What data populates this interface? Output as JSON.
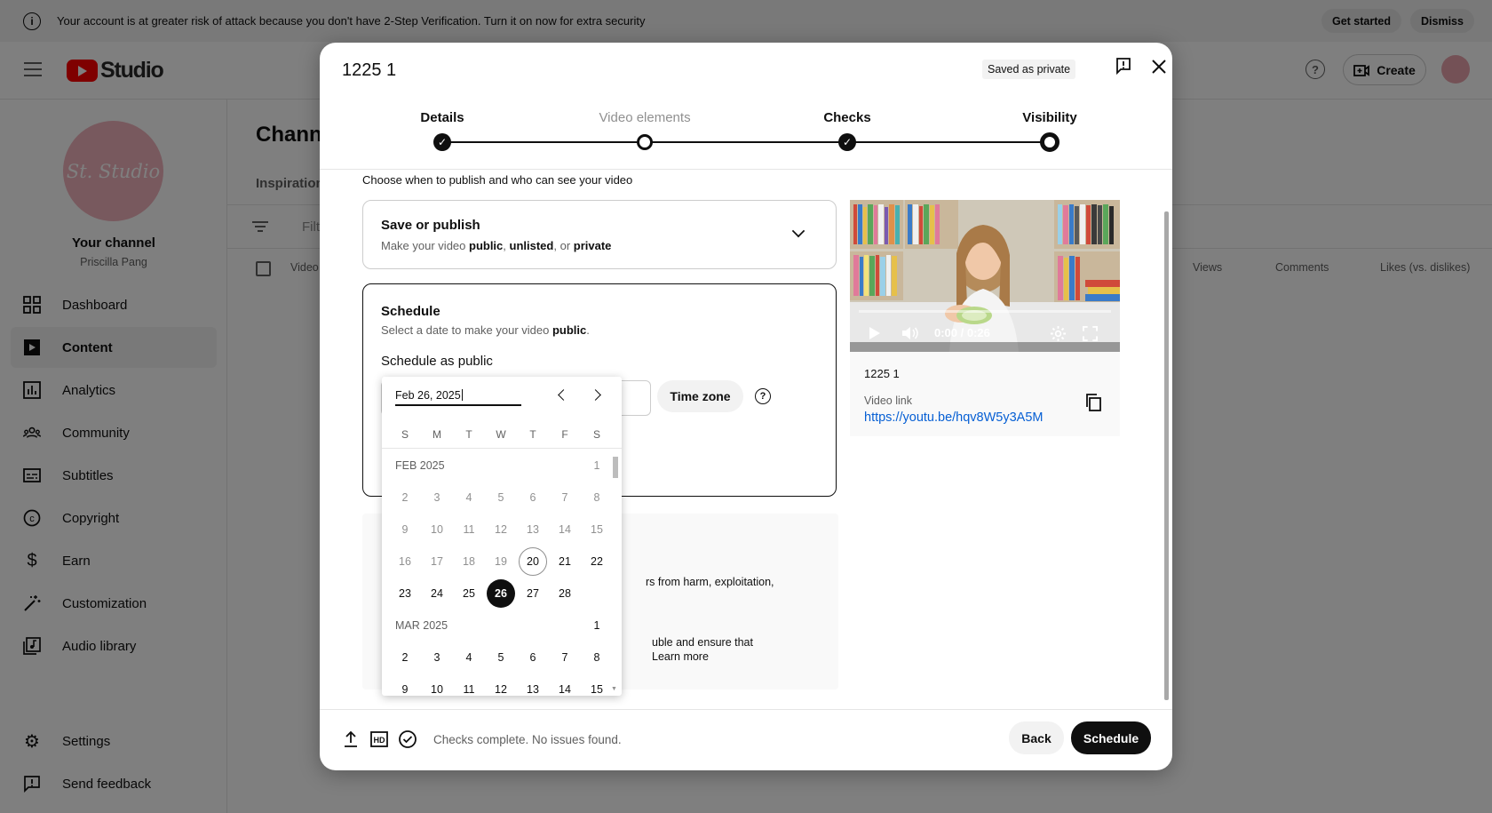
{
  "banner": {
    "text": "Your account is at greater risk of attack because you don't have 2-Step Verification. Turn it on now for extra security",
    "get_started": "Get started",
    "dismiss": "Dismiss"
  },
  "header": {
    "logo_text": "Studio",
    "create_label": "Create"
  },
  "sidebar": {
    "channel_avatar_text": "St. Studio",
    "channel_title": "Your channel",
    "channel_name": "Priscilla Pang",
    "items": [
      {
        "label": "Dashboard",
        "icon": "dashboard-icon"
      },
      {
        "label": "Content",
        "icon": "content-icon",
        "active": true
      },
      {
        "label": "Analytics",
        "icon": "analytics-icon"
      },
      {
        "label": "Community",
        "icon": "community-icon"
      },
      {
        "label": "Subtitles",
        "icon": "subtitles-icon"
      },
      {
        "label": "Copyright",
        "icon": "copyright-icon"
      },
      {
        "label": "Earn",
        "icon": "earn-icon"
      },
      {
        "label": "Customization",
        "icon": "customization-icon"
      },
      {
        "label": "Audio library",
        "icon": "audio-library-icon"
      }
    ],
    "settings": "Settings",
    "feedback": "Send feedback"
  },
  "main": {
    "title": "Chann",
    "tab": "Inspiration",
    "filter_placeholder": "Filt",
    "columns": {
      "video": "Video",
      "views": "Views",
      "comments": "Comments",
      "likes": "Likes (vs. dislikes)"
    }
  },
  "dialog": {
    "title": "1225 1",
    "saved_badge": "Saved as private",
    "steps": [
      {
        "label": "Details",
        "state": "done"
      },
      {
        "label": "Video elements",
        "state": "open"
      },
      {
        "label": "Checks",
        "state": "done"
      },
      {
        "label": "Visibility",
        "state": "current"
      }
    ],
    "intro": "Choose when to publish and who can see your video",
    "save_publish": {
      "heading": "Save or publish",
      "sub_prefix": "Make your video ",
      "opt1": "public",
      "sep1": ", ",
      "opt2": "unlisted",
      "sep2": ", or ",
      "opt3": "private"
    },
    "schedule": {
      "heading": "Schedule",
      "sub_prefix": "Select a date to make your video ",
      "sub_bold": "public",
      "sub_suffix": ".",
      "as_public": "Schedule as public",
      "time_zone": "Time zone"
    },
    "notice": {
      "line1": "rs from harm, exploitation,",
      "line2": "uble and ensure that",
      "learn_more": "Learn more"
    },
    "video": {
      "time": "0:00 / 0:26",
      "title": "1225 1",
      "link_label": "Video link",
      "link": "https://youtu.be/hqv8W5y3A5M"
    },
    "footer": {
      "status": "Checks complete. No issues found.",
      "back": "Back",
      "schedule": "Schedule"
    }
  },
  "calendar": {
    "input_value": "Feb 26, 2025",
    "weekdays": [
      "S",
      "M",
      "T",
      "W",
      "T",
      "F",
      "S"
    ],
    "months": [
      {
        "label": "FEB 2025",
        "weeks": [
          [
            "",
            "",
            "",
            "",
            "",
            "",
            "1"
          ],
          [
            "2",
            "3",
            "4",
            "5",
            "6",
            "7",
            "8"
          ],
          [
            "9",
            "10",
            "11",
            "12",
            "13",
            "14",
            "15"
          ],
          [
            "16",
            "17",
            "18",
            "19",
            "20",
            "21",
            "22"
          ],
          [
            "23",
            "24",
            "25",
            "26",
            "27",
            "28",
            ""
          ]
        ]
      },
      {
        "label": "MAR 2025",
        "weeks": [
          [
            "",
            "",
            "",
            "",
            "",
            "",
            "1"
          ],
          [
            "2",
            "3",
            "4",
            "5",
            "6",
            "7",
            "8"
          ],
          [
            "9",
            "10",
            "11",
            "12",
            "13",
            "14",
            "15"
          ]
        ]
      }
    ],
    "today": "20",
    "selected": "26"
  }
}
